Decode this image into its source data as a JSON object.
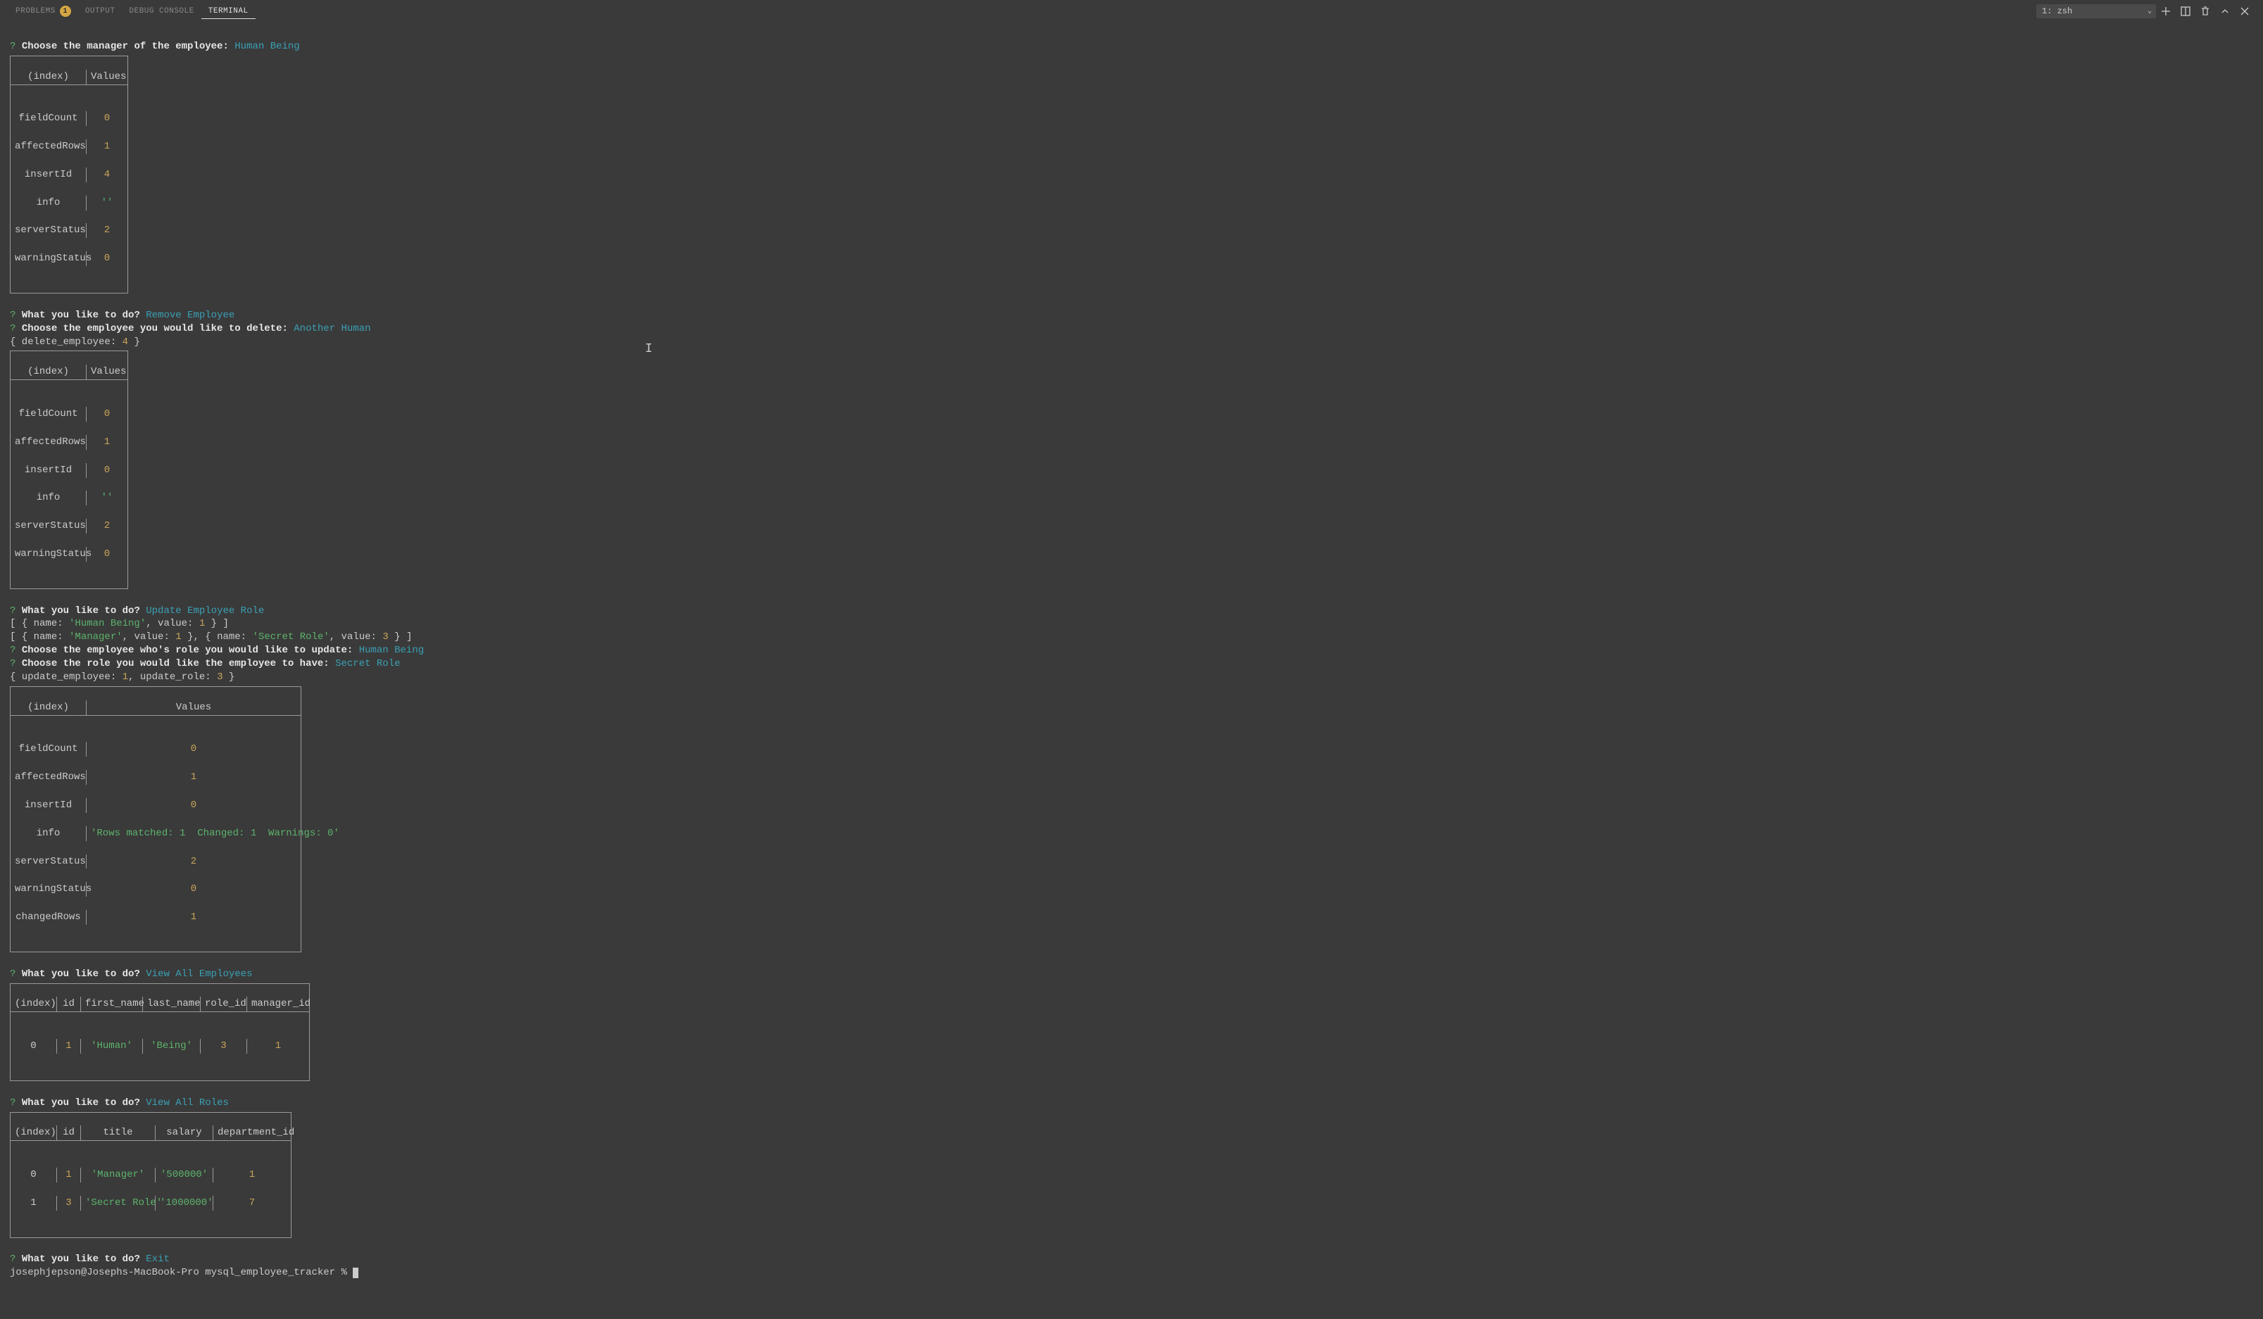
{
  "tabs": {
    "problems": "PROBLEMS",
    "problems_badge": "1",
    "output": "OUTPUT",
    "debug": "DEBUG CONSOLE",
    "terminal": "TERMINAL"
  },
  "terminal_select": "1: zsh",
  "lines": {
    "q1_prompt": "Choose the manager of the employee:",
    "q1_answer": "Human Being",
    "q2_prompt": "What you like to do?",
    "q2_answer": "Remove Employee",
    "q3_prompt": "Choose the employee you would like to delete:",
    "q3_answer": "Another Human",
    "delete_obj": "{ delete_employee: ",
    "delete_val": "4",
    "delete_end": " }",
    "q4_prompt": "What you like to do?",
    "q4_answer": "Update Employee Role",
    "arr1a": "[ { name: ",
    "arr1b": "'Human Being'",
    "arr1c": ", value: ",
    "arr1d": "1",
    "arr1e": " } ]",
    "arr2a": "[ { name: ",
    "arr2b": "'Manager'",
    "arr2c": ", value: ",
    "arr2d": "1",
    "arr2e": " }, { name: ",
    "arr2f": "'Secret Role'",
    "arr2g": ", value: ",
    "arr2h": "3",
    "arr2i": " } ]",
    "q5_prompt": "Choose the employee who's role you would like to update:",
    "q5_answer": "Human Being",
    "q6_prompt": "Choose the role you would like the employee to have:",
    "q6_answer": "Secret Role",
    "update_a": "{ update_employee: ",
    "update_b": "1",
    "update_c": ", update_role: ",
    "update_d": "3",
    "update_e": " }",
    "q7_prompt": "What you like to do?",
    "q7_answer": "View All Employees",
    "q8_prompt": "What you like to do?",
    "q8_answer": "View All Roles",
    "q9_prompt": "What you like to do?",
    "q9_answer": "Exit",
    "shell_prompt": "josephjepson@Josephs-MacBook-Pro mysql_employee_tracker % "
  },
  "table1": {
    "h1": "(index)",
    "h2": "Values",
    "r1a": "fieldCount",
    "r1b": "0",
    "r2a": "affectedRows",
    "r2b": "1",
    "r3a": "insertId",
    "r3b": "4",
    "r4a": "info",
    "r4b": "''",
    "r5a": "serverStatus",
    "r5b": "2",
    "r6a": "warningStatus",
    "r6b": "0"
  },
  "table2": {
    "h1": "(index)",
    "h2": "Values",
    "r1a": "fieldCount",
    "r1b": "0",
    "r2a": "affectedRows",
    "r2b": "1",
    "r3a": "insertId",
    "r3b": "0",
    "r4a": "info",
    "r4b": "''",
    "r5a": "serverStatus",
    "r5b": "2",
    "r6a": "warningStatus",
    "r6b": "0"
  },
  "table3": {
    "h1": "(index)",
    "h2": "Values",
    "r1a": "fieldCount",
    "r1b": "0",
    "r2a": "affectedRows",
    "r2b": "1",
    "r3a": "insertId",
    "r3b": "0",
    "r4a": "info",
    "r4b": "'Rows matched: 1  Changed: 1  Warnings: 0'",
    "r5a": "serverStatus",
    "r5b": "2",
    "r6a": "warningStatus",
    "r6b": "0",
    "r7a": "changedRows",
    "r7b": "1"
  },
  "table4": {
    "h1": "(index)",
    "h2": "id",
    "h3": "first_name",
    "h4": "last_name",
    "h5": "role_id",
    "h6": "manager_id",
    "r1a": "0",
    "r1b": "1",
    "r1c": "'Human'",
    "r1d": "'Being'",
    "r1e": "3",
    "r1f": "1"
  },
  "table5": {
    "h1": "(index)",
    "h2": "id",
    "h3": "title",
    "h4": "salary",
    "h5": "department_id",
    "r1a": "0",
    "r1b": "1",
    "r1c": "'Manager'",
    "r1d": "'500000'",
    "r1e": "1",
    "r2a": "1",
    "r2b": "3",
    "r2c": "'Secret Role'",
    "r2d": "'1000000'",
    "r2e": "7"
  }
}
